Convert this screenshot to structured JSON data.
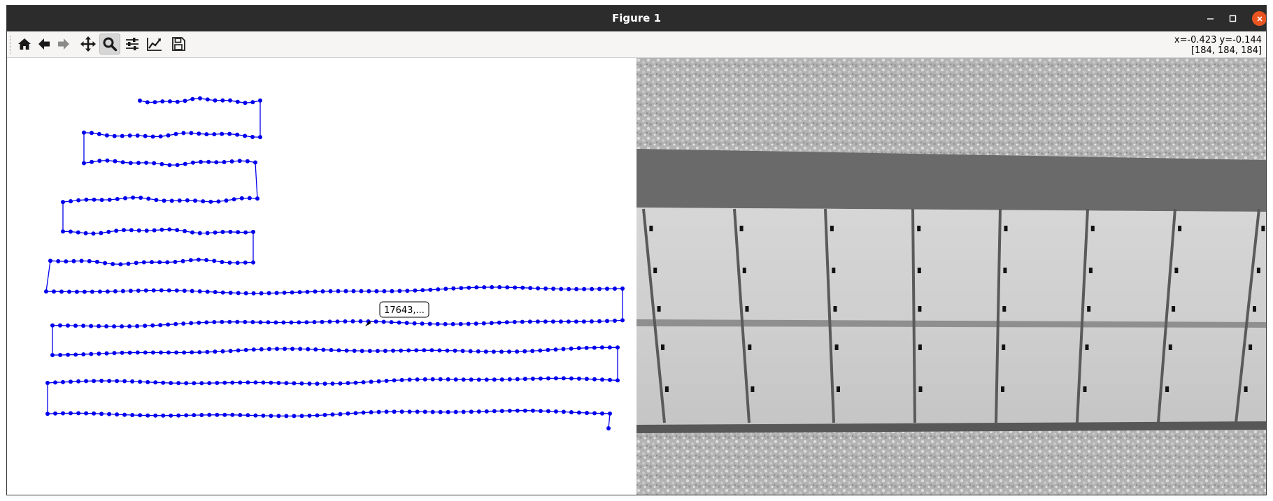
{
  "window": {
    "title": "Figure 1",
    "buttons": {
      "minimize": "–",
      "maximize": "□",
      "close": "✕"
    }
  },
  "toolbar": {
    "tools": [
      {
        "name": "home-button",
        "icon": "home-icon"
      },
      {
        "name": "back-button",
        "icon": "arrow-left-icon"
      },
      {
        "name": "forward-button",
        "icon": "arrow-right-icon"
      },
      {
        "name": "pan-button",
        "icon": "move-icon"
      },
      {
        "name": "zoom-button",
        "icon": "magnifier-icon",
        "active": true
      },
      {
        "name": "subplots-button",
        "icon": "sliders-icon"
      },
      {
        "name": "customize-button",
        "icon": "line-chart-icon"
      },
      {
        "name": "save-button",
        "icon": "floppy-disk-icon"
      }
    ],
    "coordinates": "x=-0.423 y=-0.144",
    "pixel_value": "[184, 184, 184]"
  },
  "figure": {
    "annotation_text": "17643,...",
    "line_color": "#0000ee",
    "image_description_icon": "solar-panel-thermal-image"
  }
}
